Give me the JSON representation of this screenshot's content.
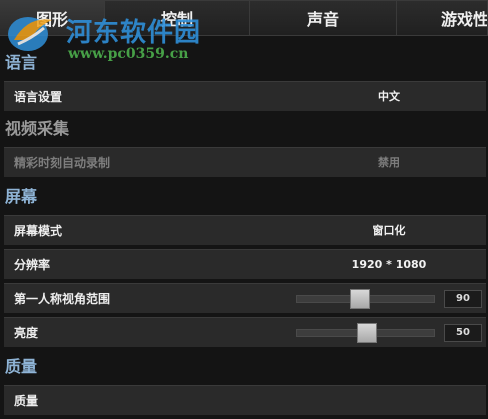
{
  "tabs": [
    {
      "label": "图形"
    },
    {
      "label": "控制"
    },
    {
      "label": "声音"
    },
    {
      "label": "游戏性"
    }
  ],
  "sections": {
    "language": "语言",
    "video_capture": "视频采集",
    "screen": "屏幕",
    "quality": "质量"
  },
  "rows": {
    "language_setting": {
      "label": "语言设置",
      "value": "中文"
    },
    "highlight_record": {
      "label": "精彩时刻自动录制",
      "value": "禁用"
    },
    "screen_mode": {
      "label": "屏幕模式",
      "value": "窗口化"
    },
    "resolution": {
      "label": "分辨率",
      "value": "1920 * 1080"
    },
    "fov": {
      "label": "第一人称视角范围",
      "value": "90",
      "level": 0.46
    },
    "brightness": {
      "label": "亮度",
      "value": "50",
      "level": 0.51
    },
    "quality": {
      "label": "质量"
    }
  },
  "watermark": {
    "title": "河东软件园",
    "url": "www.pc0359.cn"
  },
  "colors": {
    "section_header": "#8fb4d6",
    "row_bg": "#2a2a2a",
    "page_bg": "#141414",
    "watermark_blue": "#2f8fd8",
    "watermark_green": "#4aa84a"
  }
}
